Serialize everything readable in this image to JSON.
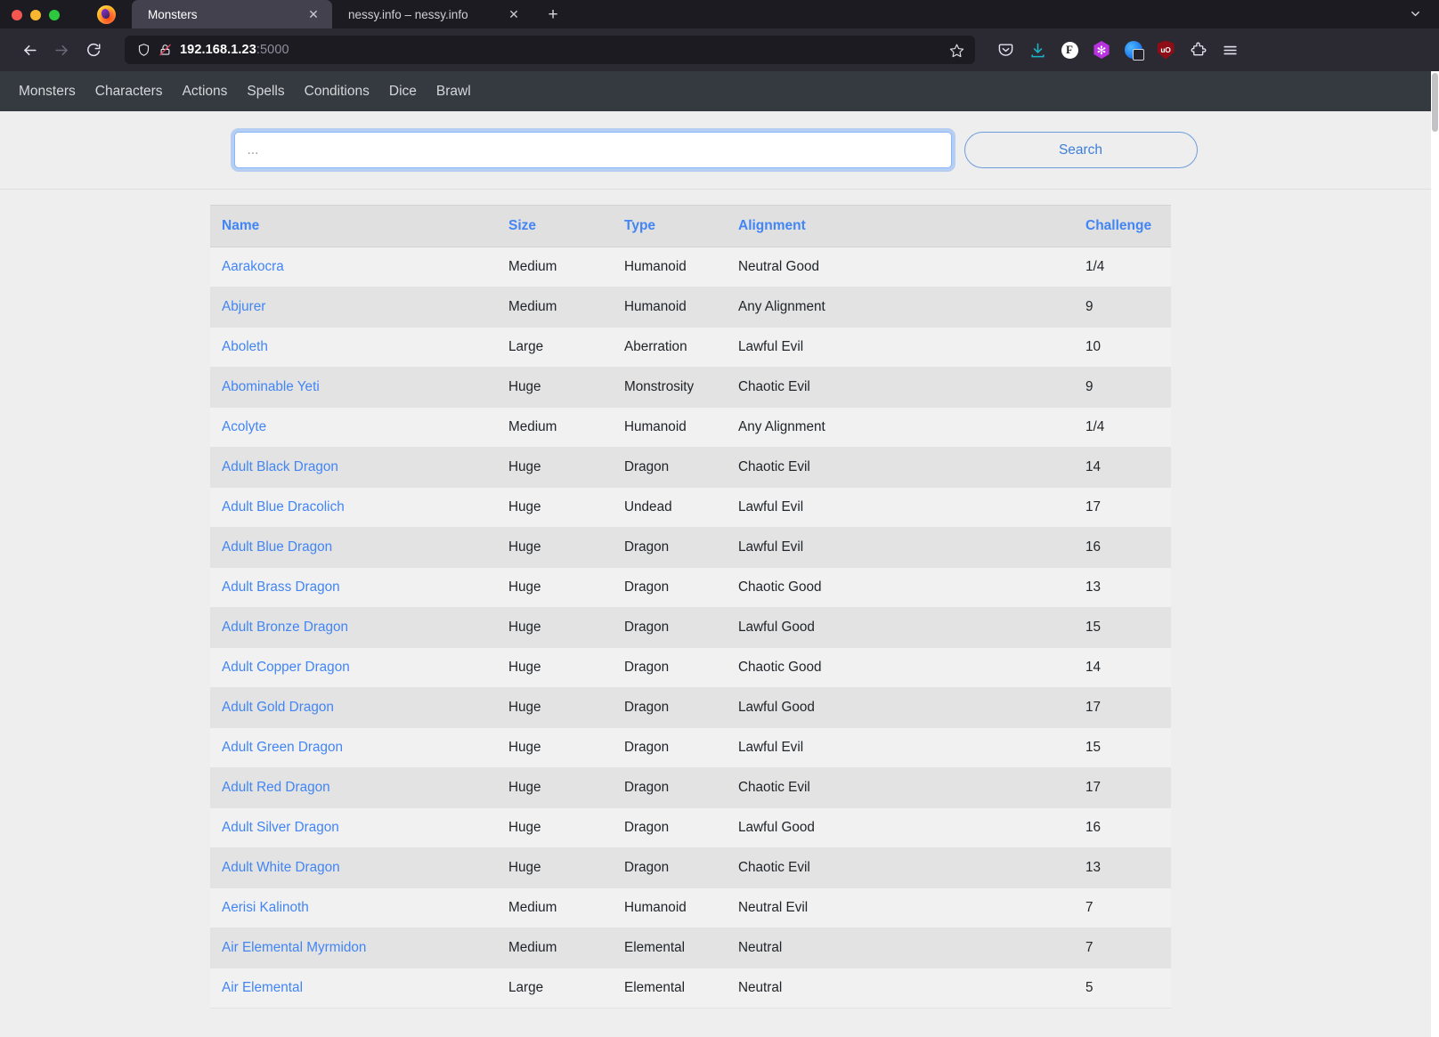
{
  "browser": {
    "window_controls": [
      "close",
      "minimize",
      "maximize"
    ],
    "app_logo": "firefox-logo",
    "tabs": [
      {
        "title": "Monsters",
        "active": true,
        "close_label": "✕"
      },
      {
        "title": "nessy.info – nessy.info",
        "active": false,
        "close_label": "✕"
      }
    ],
    "new_tab_label": "+",
    "list_all_tabs_icon": "chevron-down-icon",
    "nav": {
      "back_icon": "back-arrow-icon",
      "forward_icon": "forward-arrow-icon",
      "reload_icon": "reload-icon"
    },
    "url": {
      "host": "192.168.1.23",
      "port": ":5000",
      "shield_icon": "tracking-protection-shield-icon",
      "lock_icon": "insecure-padlock-icon",
      "bookmark_icon": "star-icon"
    },
    "toolbar_icons": [
      {
        "name": "pocket-icon",
        "label": ""
      },
      {
        "name": "downloads-icon",
        "label": ""
      },
      {
        "name": "extension-f-icon",
        "label": "F"
      },
      {
        "name": "extension-hexagon-icon",
        "label": "✻"
      },
      {
        "name": "extension-privacy-icon",
        "label": ""
      },
      {
        "name": "ublock-origin-icon",
        "label": "uO"
      },
      {
        "name": "extensions-puzzle-icon",
        "label": ""
      },
      {
        "name": "app-menu-icon",
        "label": ""
      }
    ]
  },
  "site": {
    "nav_items": [
      {
        "label": "Monsters"
      },
      {
        "label": "Characters"
      },
      {
        "label": "Actions"
      },
      {
        "label": "Spells"
      },
      {
        "label": "Conditions"
      },
      {
        "label": "Dice"
      },
      {
        "label": "Brawl"
      }
    ],
    "search": {
      "value": "",
      "placeholder": "...",
      "button_label": "Search"
    },
    "table": {
      "columns": [
        "Name",
        "Size",
        "Type",
        "Alignment",
        "Challenge"
      ],
      "rows": [
        {
          "name": "Aarakocra",
          "size": "Medium",
          "type": "Humanoid",
          "alignment": "Neutral Good",
          "challenge": "1/4"
        },
        {
          "name": "Abjurer",
          "size": "Medium",
          "type": "Humanoid",
          "alignment": "Any Alignment",
          "challenge": "9"
        },
        {
          "name": "Aboleth",
          "size": "Large",
          "type": "Aberration",
          "alignment": "Lawful Evil",
          "challenge": "10"
        },
        {
          "name": "Abominable Yeti",
          "size": "Huge",
          "type": "Monstrosity",
          "alignment": "Chaotic Evil",
          "challenge": "9"
        },
        {
          "name": "Acolyte",
          "size": "Medium",
          "type": "Humanoid",
          "alignment": "Any Alignment",
          "challenge": "1/4"
        },
        {
          "name": "Adult Black Dragon",
          "size": "Huge",
          "type": "Dragon",
          "alignment": "Chaotic Evil",
          "challenge": "14"
        },
        {
          "name": "Adult Blue Dracolich",
          "size": "Huge",
          "type": "Undead",
          "alignment": "Lawful Evil",
          "challenge": "17"
        },
        {
          "name": "Adult Blue Dragon",
          "size": "Huge",
          "type": "Dragon",
          "alignment": "Lawful Evil",
          "challenge": "16"
        },
        {
          "name": "Adult Brass Dragon",
          "size": "Huge",
          "type": "Dragon",
          "alignment": "Chaotic Good",
          "challenge": "13"
        },
        {
          "name": "Adult Bronze Dragon",
          "size": "Huge",
          "type": "Dragon",
          "alignment": "Lawful Good",
          "challenge": "15"
        },
        {
          "name": "Adult Copper Dragon",
          "size": "Huge",
          "type": "Dragon",
          "alignment": "Chaotic Good",
          "challenge": "14"
        },
        {
          "name": "Adult Gold Dragon",
          "size": "Huge",
          "type": "Dragon",
          "alignment": "Lawful Good",
          "challenge": "17"
        },
        {
          "name": "Adult Green Dragon",
          "size": "Huge",
          "type": "Dragon",
          "alignment": "Lawful Evil",
          "challenge": "15"
        },
        {
          "name": "Adult Red Dragon",
          "size": "Huge",
          "type": "Dragon",
          "alignment": "Chaotic Evil",
          "challenge": "17"
        },
        {
          "name": "Adult Silver Dragon",
          "size": "Huge",
          "type": "Dragon",
          "alignment": "Lawful Good",
          "challenge": "16"
        },
        {
          "name": "Adult White Dragon",
          "size": "Huge",
          "type": "Dragon",
          "alignment": "Chaotic Evil",
          "challenge": "13"
        },
        {
          "name": "Aerisi Kalinoth",
          "size": "Medium",
          "type": "Humanoid",
          "alignment": "Neutral Evil",
          "challenge": "7"
        },
        {
          "name": "Air Elemental Myrmidon",
          "size": "Medium",
          "type": "Elemental",
          "alignment": "Neutral",
          "challenge": "7"
        },
        {
          "name": "Air Elemental",
          "size": "Large",
          "type": "Elemental",
          "alignment": "Neutral",
          "challenge": "5"
        }
      ]
    }
  },
  "colors": {
    "navbar_bg": "#343a40",
    "link_blue": "#4285f4",
    "page_bg": "#eeeeee",
    "row_odd": "#f1f1f1",
    "row_even": "#e3e3e3",
    "header_row": "#e0e0e0",
    "focus_ring": "#86b7fe",
    "button_border": "#6e9ddb"
  }
}
